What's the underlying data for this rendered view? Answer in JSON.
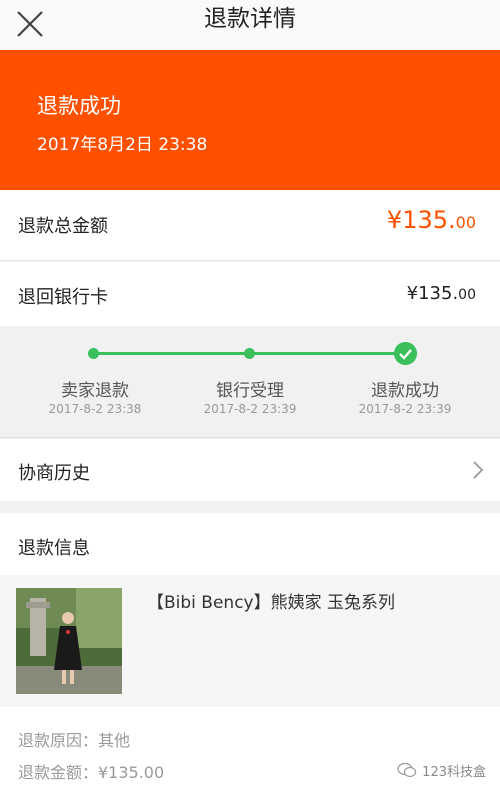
{
  "nav": {
    "title": "退款详情"
  },
  "banner": {
    "status": "退款成功",
    "time": "2017年8月2日 23:38"
  },
  "total": {
    "label": "退款总金额",
    "amount_main": "¥135.",
    "amount_cents": "00"
  },
  "bank": {
    "label": "退回银行卡",
    "amount_main": "¥135.",
    "amount_cents": "00"
  },
  "progress": {
    "steps": [
      {
        "name": "卖家退款",
        "time": "2017-8-2 23:38"
      },
      {
        "name": "银行受理",
        "time": "2017-8-2 23:39"
      },
      {
        "name": "退款成功",
        "time": "2017-8-2 23:39"
      }
    ],
    "accent_color": "#3bbf5a"
  },
  "history": {
    "label": "协商历史"
  },
  "info": {
    "header": "退款信息",
    "product_name": "【Bibi Bency】熊姨家 玉兔系列",
    "reason": "退款原因：其他",
    "amount": "退款金额：¥135.00"
  },
  "watermark": {
    "text": "123科技盒"
  },
  "colors": {
    "brand": "#ff5000",
    "success": "#3bbf5a"
  }
}
